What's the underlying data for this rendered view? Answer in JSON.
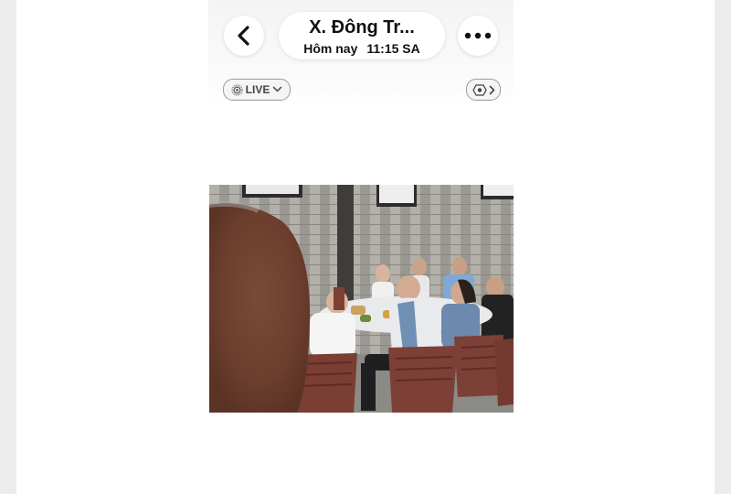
{
  "header": {
    "title": "X. Đông Tr...",
    "date_label": "Hôm nay",
    "time_label": "11:15 SA"
  },
  "live_badge": {
    "label": "LIVE"
  },
  "icons": {
    "back": "chevron-left-icon",
    "more": "more-dots-icon",
    "live": "live-circle-icon",
    "live_dropdown": "chevron-down-icon",
    "scan": "visual-lookup-icon",
    "scan_chevron": "chevron-right-icon"
  },
  "photo": {
    "subject": "group of people at a dining table in a restaurant room"
  }
}
